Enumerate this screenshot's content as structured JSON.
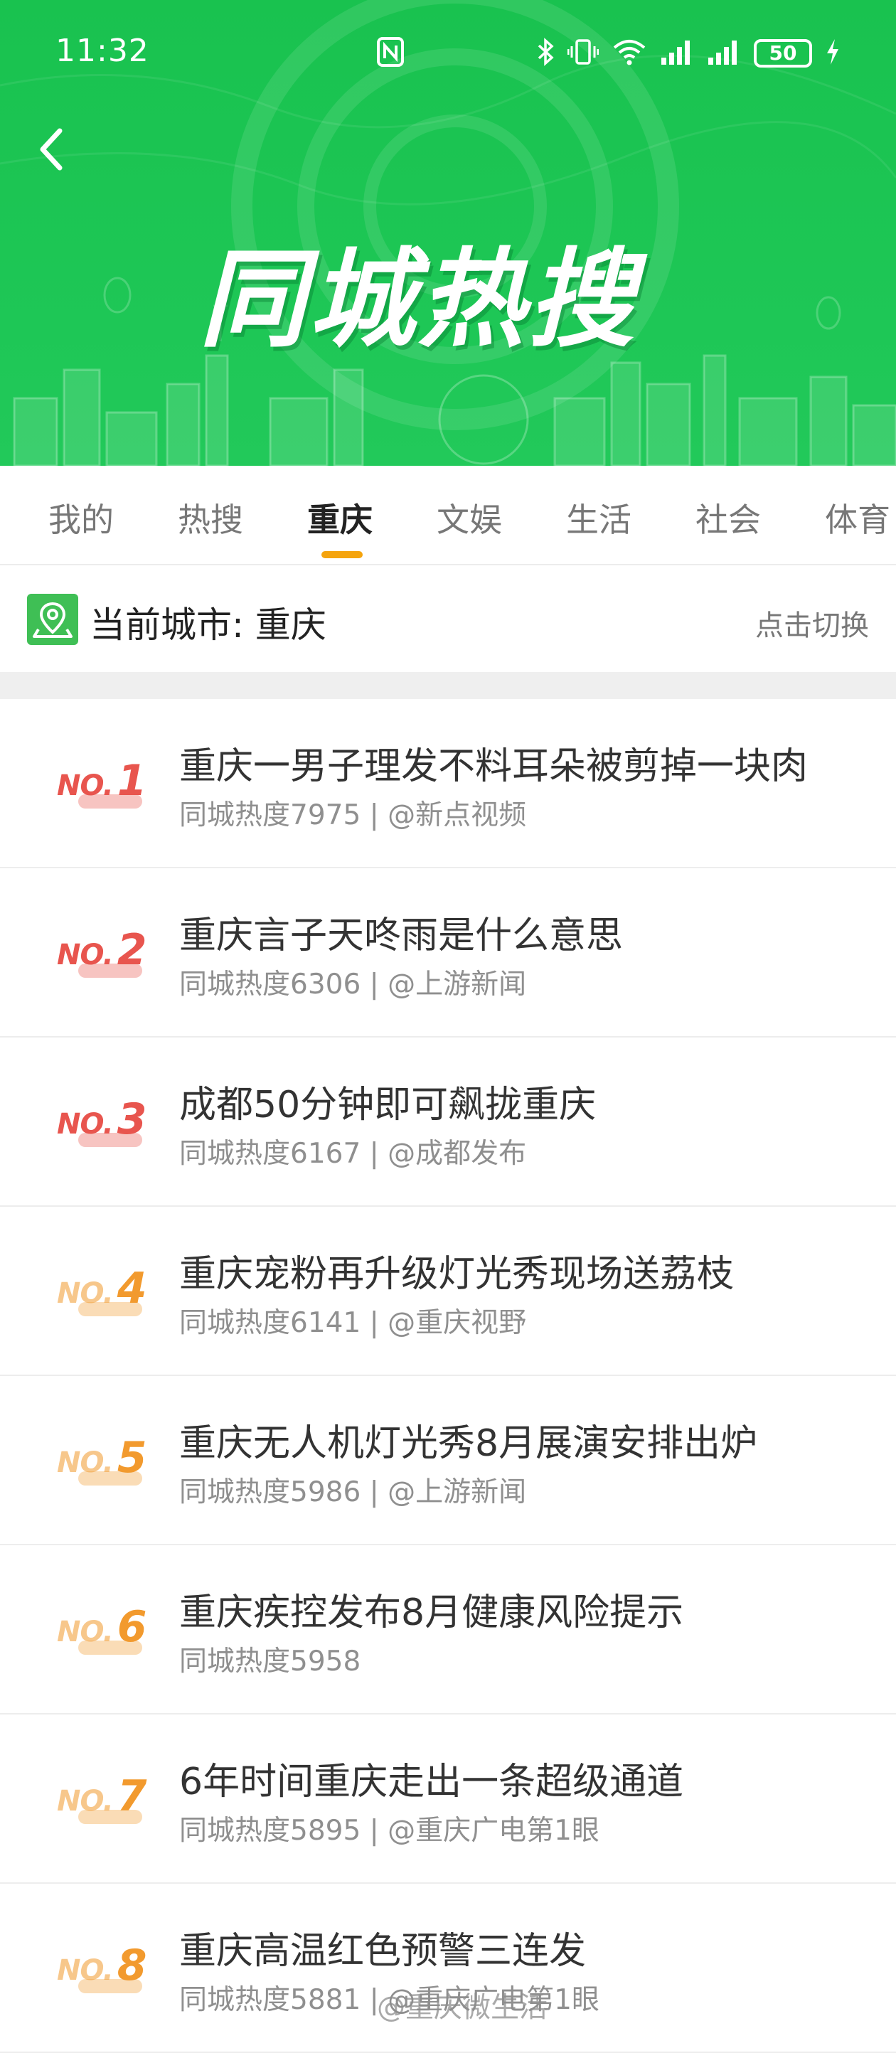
{
  "status_bar": {
    "time": "11:32",
    "battery": "50",
    "icons": [
      "nfc-icon",
      "bluetooth-icon",
      "vibrate-icon",
      "wifi-icon",
      "signal-icon",
      "signal-icon",
      "battery-icon",
      "charging-icon"
    ]
  },
  "header": {
    "title": "同城热搜",
    "back_icon": "chevron-left-icon"
  },
  "tabs": [
    {
      "label": "我的",
      "active": false
    },
    {
      "label": "热搜",
      "active": false
    },
    {
      "label": "重庆",
      "active": true
    },
    {
      "label": "文娱",
      "active": false
    },
    {
      "label": "生活",
      "active": false
    },
    {
      "label": "社会",
      "active": false
    },
    {
      "label": "体育",
      "active": false
    }
  ],
  "city_bar": {
    "label": "当前城市: 重庆",
    "switch": "点击切换",
    "icon": "location-pin-icon"
  },
  "list": [
    {
      "rank_prefix": "NO.",
      "rank": "1",
      "title": "重庆一男子理发不料耳朵被剪掉一块肉",
      "meta": "同城热度7975 | @新点视频",
      "rank_color": "#e8554e"
    },
    {
      "rank_prefix": "NO.",
      "rank": "2",
      "title": "重庆言子天咚雨是什么意思",
      "meta": "同城热度6306 | @上游新闻",
      "rank_color": "#e8554e"
    },
    {
      "rank_prefix": "NO.",
      "rank": "3",
      "title": "成都50分钟即可飙拢重庆",
      "meta": "同城热度6167 | @成都发布",
      "rank_color": "#e8554e"
    },
    {
      "rank_prefix": "NO.",
      "rank": "4",
      "title": "重庆宠粉再升级灯光秀现场送荔枝",
      "meta": "同城热度6141 | @重庆视野",
      "rank_color": "#f29a2e"
    },
    {
      "rank_prefix": "NO.",
      "rank": "5",
      "title": "重庆无人机灯光秀8月展演安排出炉",
      "meta": "同城热度5986 | @上游新闻",
      "rank_color": "#f29a2e"
    },
    {
      "rank_prefix": "NO.",
      "rank": "6",
      "title": "重庆疾控发布8月健康风险提示",
      "meta": "同城热度5958",
      "rank_color": "#f29a2e"
    },
    {
      "rank_prefix": "NO.",
      "rank": "7",
      "title": "6年时间重庆走出一条超级通道",
      "meta": "同城热度5895 | @重庆广电第1眼",
      "rank_color": "#f29a2e"
    },
    {
      "rank_prefix": "NO.",
      "rank": "8",
      "title": "重庆高温红色预警三连发",
      "meta": "同城热度5881 | @重庆广电第1眼",
      "rank_color": "#f29a2e"
    }
  ],
  "watermark": "@重庆微生活"
}
